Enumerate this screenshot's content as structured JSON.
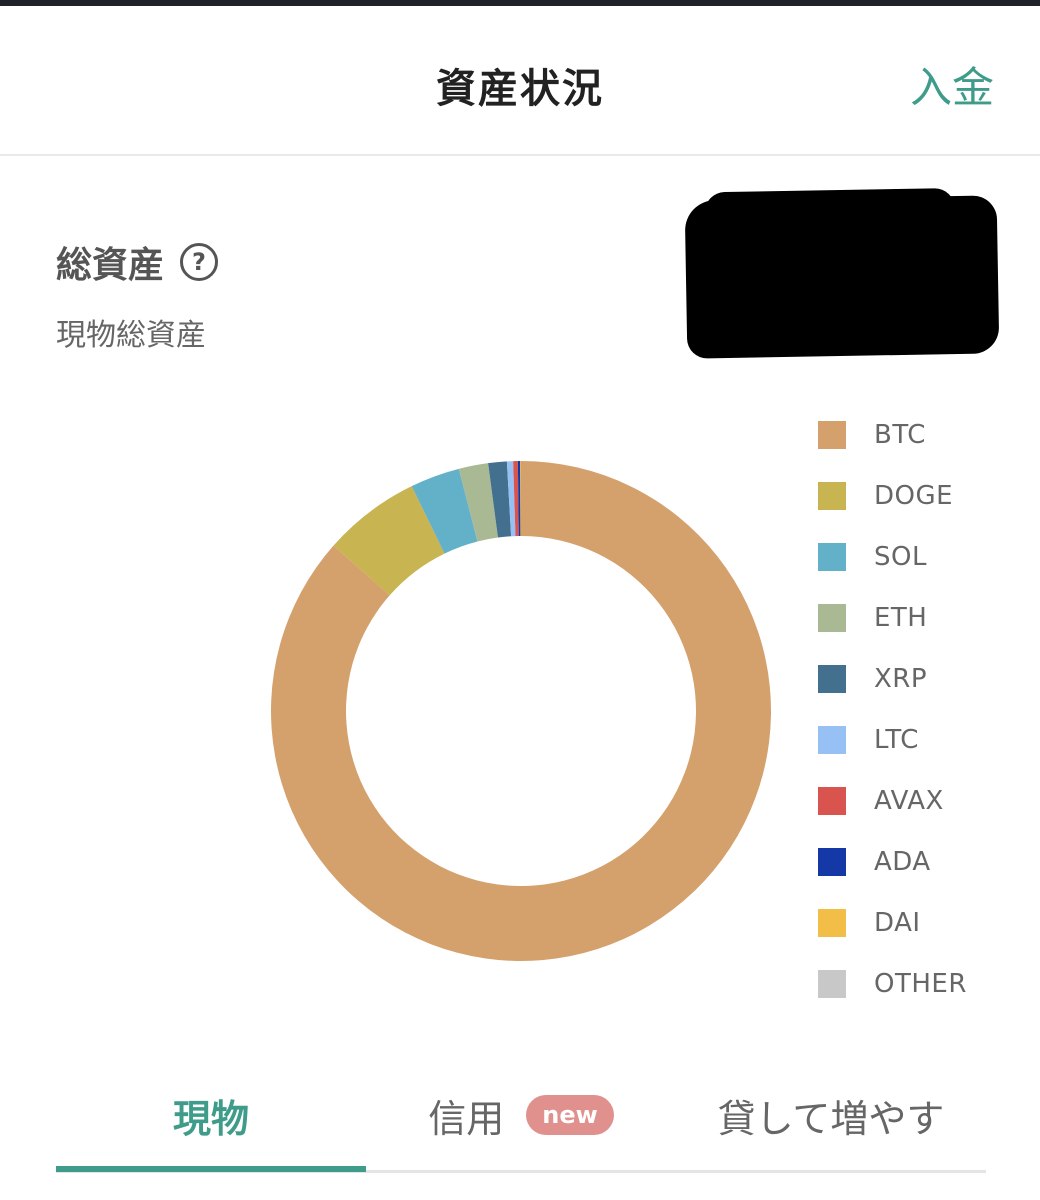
{
  "header": {
    "title": "資産状況",
    "deposit_label": "入金"
  },
  "summary": {
    "total_label": "総資産",
    "help_glyph": "?",
    "sub_label": "現物総資産"
  },
  "colors": {
    "accent": "#3f9c8a",
    "badge": "#e0908d"
  },
  "chart_data": {
    "type": "pie",
    "donut": true,
    "legend_position": "right",
    "categories": [
      "BTC",
      "DOGE",
      "SOL",
      "ETH",
      "XRP",
      "LTC",
      "AVAX",
      "ADA",
      "DAI",
      "OTHER"
    ],
    "values": [
      86.5,
      6.3,
      3.2,
      1.9,
      1.2,
      0.4,
      0.3,
      0.15,
      0.05,
      0.0
    ],
    "colors": [
      "#d4a06b",
      "#c8b451",
      "#62b1c8",
      "#a9b994",
      "#44708f",
      "#97c1f5",
      "#d9534f",
      "#1538a7",
      "#f2be48",
      "#c8c8c8"
    ]
  },
  "tabs": [
    {
      "label": "現物",
      "active": true
    },
    {
      "label": "信用",
      "badge": "new",
      "active": false
    },
    {
      "label": "貸して増やす",
      "active": false
    }
  ]
}
